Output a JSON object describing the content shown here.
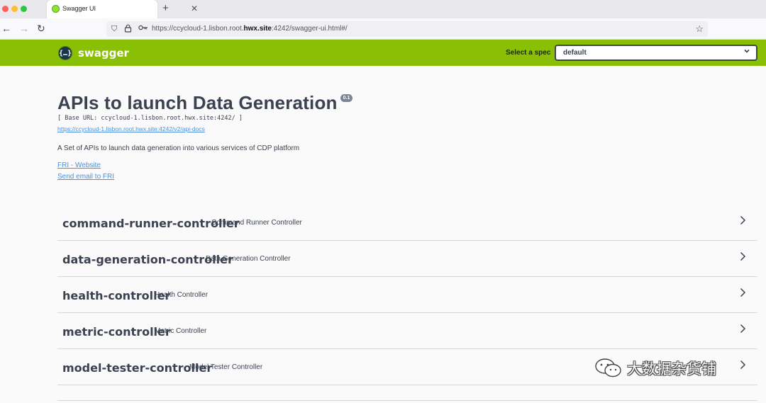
{
  "browser": {
    "tab_title": "Swagger UI",
    "tab_close": "✕",
    "new_tab": "+",
    "url_prefix": "https://ccycloud-1.lisbon.root.",
    "url_domain": "hwx.site",
    "url_suffix": ":4242/swagger-ui.html#/"
  },
  "topbar": {
    "logo_mark": "{…}",
    "logo_text": "swagger",
    "spec_label": "Select a spec",
    "spec_value": "default"
  },
  "info": {
    "title": "APIs to launch Data Generation",
    "version": "0.1",
    "base_url": "[ Base URL: ccycloud-1.lisbon.root.hwx.site:4242/ ]",
    "docs_link": "https://ccycloud-1.lisbon.root.hwx.site:4242/v2/api-docs",
    "description": "A Set of APIs to launch data generation into various services of CDP platform",
    "website_link": "FRI - Website",
    "email_link": "Send email to FRI"
  },
  "tags": [
    {
      "name": "command-runner-controller",
      "description": "Command Runner Controller"
    },
    {
      "name": "data-generation-controller",
      "description": "Data Generation Controller"
    },
    {
      "name": "health-controller",
      "description": "Health Controller"
    },
    {
      "name": "metric-controller",
      "description": "Metric Controller"
    },
    {
      "name": "model-tester-controller",
      "description": "Model Tester Controller"
    }
  ],
  "watermark": {
    "text": "大数据杂货铺"
  },
  "colors": {
    "topbar": "#89bf04",
    "text": "#3b4151",
    "link": "#4990e2"
  }
}
